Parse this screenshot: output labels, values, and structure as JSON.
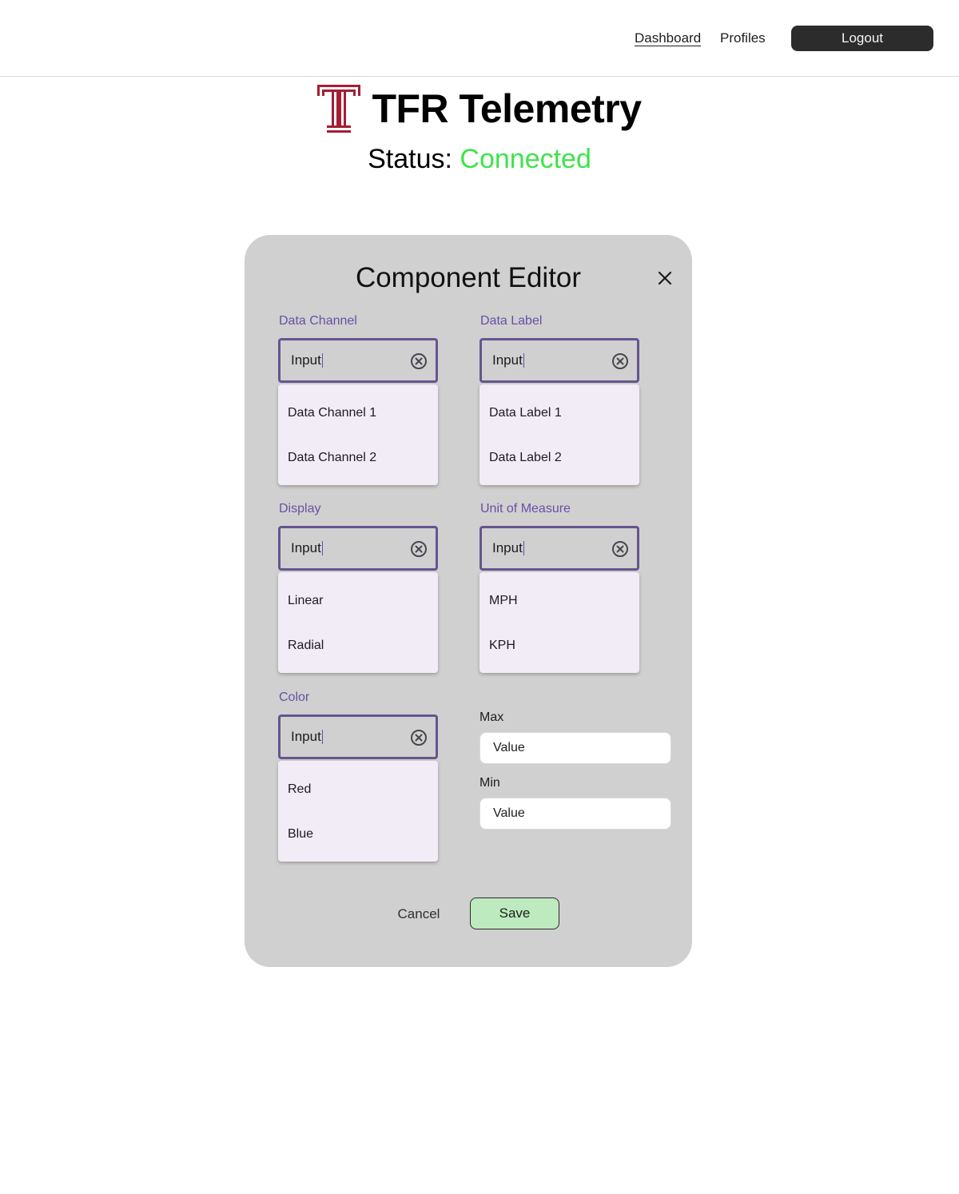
{
  "nav": {
    "dashboard": "Dashboard",
    "profiles": "Profiles",
    "logout": "Logout"
  },
  "brand": {
    "title": "TFR Telemetry",
    "logo_icon": "temple-t-logo",
    "logo_color": "#a41e34"
  },
  "status": {
    "label": "Status:",
    "value": "Connected",
    "value_color": "#3ee34a"
  },
  "editor": {
    "title": "Component Editor",
    "close_icon": "close-icon",
    "fields": {
      "data_channel": {
        "label": "Data Channel",
        "value": "Input",
        "options": [
          "Data Channel 1",
          "Data Channel 2"
        ]
      },
      "data_label": {
        "label": "Data Label",
        "value": "Input",
        "options": [
          "Data Label 1",
          "Data Label 2"
        ]
      },
      "display": {
        "label": "Display",
        "value": "Input",
        "options": [
          "Linear",
          "Radial"
        ]
      },
      "unit": {
        "label": "Unit of Measure",
        "value": "Input",
        "options": [
          "MPH",
          "KPH"
        ]
      },
      "color": {
        "label": "Color",
        "value": "Input",
        "options": [
          "Red",
          "Blue"
        ]
      }
    },
    "max": {
      "label": "Max",
      "placeholder": "Value"
    },
    "min": {
      "label": "Min",
      "placeholder": "Value"
    },
    "cancel": "Cancel",
    "save": "Save",
    "accent_color": "#65558f",
    "save_color": "#bdeabe"
  }
}
